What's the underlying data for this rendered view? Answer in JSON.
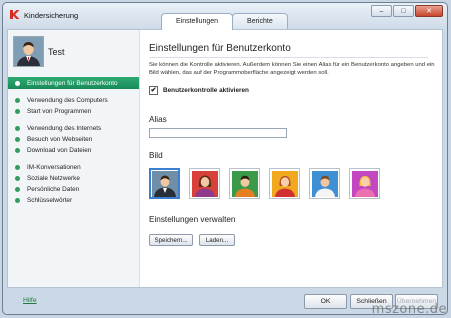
{
  "window": {
    "title": "Kindersicherung",
    "tabs": [
      {
        "label": "Einstellungen",
        "active": true
      },
      {
        "label": "Berichte",
        "active": false
      }
    ],
    "controls": {
      "minimize": "–",
      "maximize": "□",
      "close": "✕"
    }
  },
  "sidebar": {
    "user_name": "Test",
    "items": [
      {
        "label": "Einstellungen für Benutzerkonto",
        "active": true
      },
      {
        "label": "Verwendung des Computers"
      },
      {
        "label": "Start von Programmen"
      },
      {
        "label": "Verwendung des Internets"
      },
      {
        "label": "Besuch von Webseiten"
      },
      {
        "label": "Download von Dateien"
      },
      {
        "label": "IM-Konversationen"
      },
      {
        "label": "Soziale Netzwerke"
      },
      {
        "label": "Persönliche Daten"
      },
      {
        "label": "Schlüsselwörter"
      }
    ]
  },
  "main": {
    "title": "Einstellungen für Benutzerkonto",
    "description": "Sie können die Kontrolle aktivieren. Außerdem können Sie einen Alias für ein Benutzerkonto angeben und ein Bild wählen, das auf der Programmoberfläche angezeigt werden soll.",
    "checkbox_label": "Benutzerkontrolle aktivieren",
    "checkbox_checked": true,
    "alias_label": "Alias",
    "alias_value": "",
    "picture_label": "Bild",
    "pictures": [
      {
        "name": "man-suit",
        "bg": "#6f8fa8",
        "selected": true
      },
      {
        "name": "woman",
        "bg": "#d8403a"
      },
      {
        "name": "boy",
        "bg": "#3b9a48"
      },
      {
        "name": "girl",
        "bg": "#f0a81e"
      },
      {
        "name": "child",
        "bg": "#3f8fd4"
      },
      {
        "name": "girl-pink",
        "bg": "#c247c0"
      }
    ],
    "manage_label": "Einstellungen verwalten",
    "save_button": "Speichern...",
    "load_button": "Laden..."
  },
  "footer": {
    "help": "Hilfe",
    "ok": "OK",
    "close": "Schließen",
    "apply": "Übernehmen"
  },
  "watermark": "mszone.de"
}
